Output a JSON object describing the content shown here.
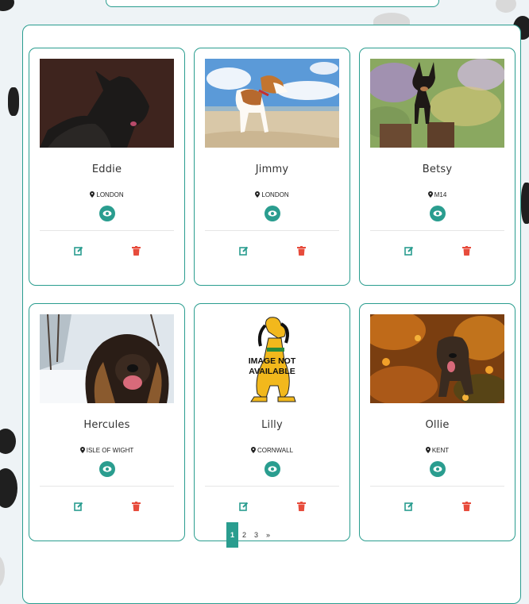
{
  "dogs": [
    {
      "name": "Eddie",
      "location": "LONDON",
      "photo_icon": "scottish-terrier-photo"
    },
    {
      "name": "Jimmy",
      "location": "LONDON",
      "photo_icon": "beagle-beach-photo"
    },
    {
      "name": "Betsy",
      "location": "M14",
      "photo_icon": "chihuahua-flowers-photo"
    },
    {
      "name": "Hercules",
      "location": "ISLE OF WIGHT",
      "photo_icon": "leonberger-snow-photo"
    },
    {
      "name": "Lilly",
      "location": "CORNWALL",
      "photo_icon": "image-not-available-placeholder"
    },
    {
      "name": "Ollie",
      "location": "KENT",
      "photo_icon": "spaniel-autumn-photo"
    }
  ],
  "placeholder": {
    "line1": "IMAGE NOT",
    "line2": "AVAILABLE"
  },
  "pagination": {
    "pages": [
      "1",
      "2",
      "3"
    ],
    "next": "»",
    "current": "1"
  },
  "colors": {
    "accent": "#2a9d8f",
    "delete": "#e74c3c"
  }
}
